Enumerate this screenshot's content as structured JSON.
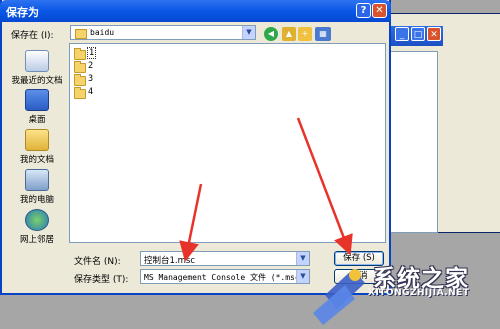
{
  "dialog": {
    "title": "保存为",
    "help_glyph": "?",
    "close_glyph": "✕"
  },
  "save_in": {
    "label": "保存在 (I):",
    "value": "baidu"
  },
  "places": [
    {
      "label": "我最近的文档",
      "icon": "recent-documents-icon"
    },
    {
      "label": "桌面",
      "icon": "desktop-icon"
    },
    {
      "label": "我的文档",
      "icon": "my-documents-icon"
    },
    {
      "label": "我的电脑",
      "icon": "my-computer-icon"
    },
    {
      "label": "网上邻居",
      "icon": "network-places-icon"
    }
  ],
  "files": [
    {
      "name": "1"
    },
    {
      "name": "2"
    },
    {
      "name": "3"
    },
    {
      "name": "4"
    }
  ],
  "filename": {
    "label": "文件名 (N):",
    "value": "控制台1.msc"
  },
  "filetype": {
    "label": "保存类型 (T):",
    "value": "MS Management Console 文件 (*.msc)"
  },
  "buttons": {
    "save": "保存 (S)",
    "cancel": "取消"
  },
  "watermark": {
    "cn": "系统之家",
    "en": "XITONGZHIJIA.NET"
  },
  "colors": {
    "title_bar": "#0a58e6",
    "arrow": "#e8332a"
  }
}
